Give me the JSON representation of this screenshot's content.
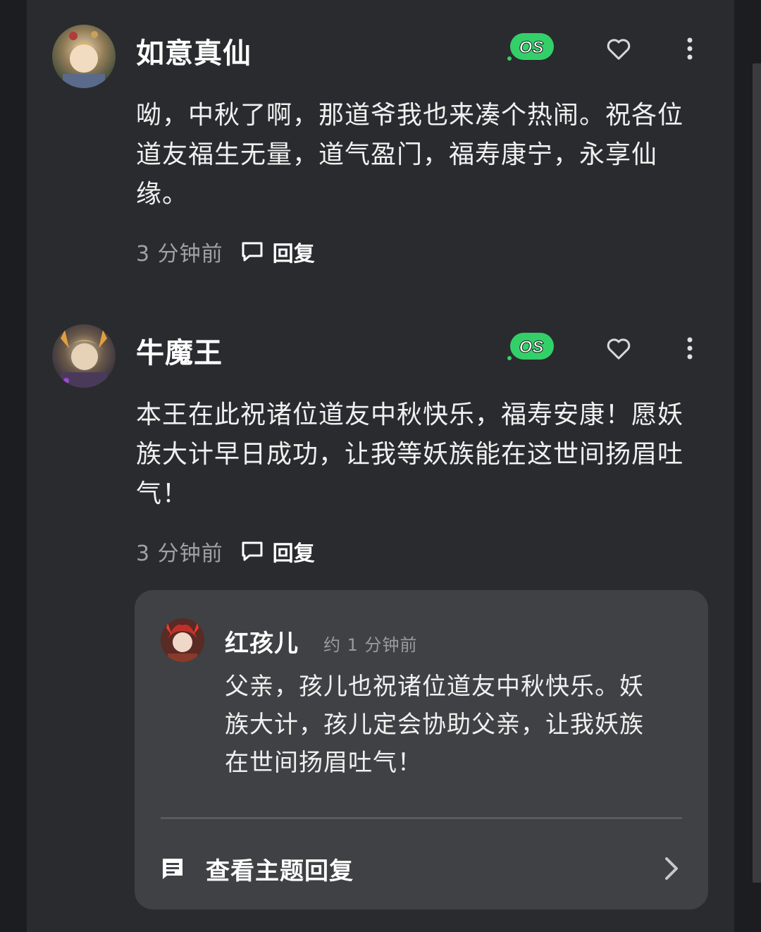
{
  "comments": [
    {
      "username": "如意真仙",
      "avatar": "avatar-ruyi",
      "badge": "OS",
      "text_lines": [
        "呦，中秋了啊，那道爷我也来凑个热闹。祝各位",
        "道友福生无量，道气盈门，福寿康宁，永享仙",
        "缘。"
      ],
      "time": "3 分钟前",
      "reply_label": "回复"
    },
    {
      "username": "牛魔王",
      "avatar": "avatar-niumo",
      "badge": "OS",
      "text_lines": [
        "本王在此祝诸位道友中秋快乐，福寿安康！愿妖",
        "族大计早日成功，让我等妖族能在这世间扬眉吐",
        "气！"
      ],
      "time": "3 分钟前",
      "reply_label": "回复"
    }
  ],
  "reply": {
    "username": "红孩儿",
    "time": "约 1 分钟前",
    "text_lines": [
      "父亲，孩儿也祝诸位道友中秋快乐。妖",
      "族大计，孩儿定会协助父亲，让我妖族",
      "在世间扬眉吐气！"
    ],
    "view_thread_label": "查看主题回复"
  },
  "colors": {
    "background": "#1c1d20",
    "panel": "#2a2b2e",
    "card": "#404144",
    "badge_green": "#33d06a",
    "text_primary": "#f0f0f0",
    "text_muted": "#a0a1a6"
  },
  "icons": [
    "os-badge-icon",
    "heart-icon",
    "more-vertical-icon",
    "chat-bubble-icon",
    "message-icon",
    "chevron-right-icon"
  ]
}
